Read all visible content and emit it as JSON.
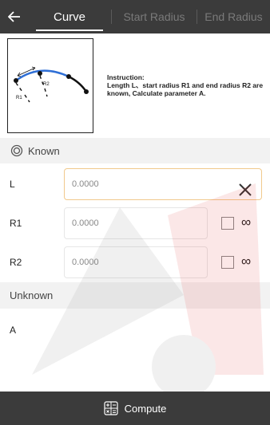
{
  "header": {
    "tabs": [
      {
        "label": "Curve",
        "active": true
      },
      {
        "label": "Start Radius",
        "active": false
      },
      {
        "label": "End Radius",
        "active": false
      }
    ]
  },
  "instruction": {
    "title": "Instruction:",
    "text": " Length L、start radius R1 and end radius R2 are known, Calculate parameter A.",
    "diagram_labels": {
      "r1": "R1",
      "r2": "R2"
    }
  },
  "known_section": {
    "label": "Known"
  },
  "fields": [
    {
      "label": "L",
      "value": "0.0000",
      "focused": true
    },
    {
      "label": "R1",
      "value": "0.0000",
      "infinity": "∞",
      "checked": false
    },
    {
      "label": "R2",
      "value": "0.0000",
      "infinity": "∞",
      "checked": false
    }
  ],
  "unknown_section": {
    "label": "Unknown",
    "result_label": "A",
    "result_value": ""
  },
  "footer": {
    "compute_label": "Compute"
  },
  "colors": {
    "bar": "#3b3b3b",
    "focus": "#f1c98c",
    "curve_blue": "#2f6fd6",
    "watermark": "#e02020"
  }
}
